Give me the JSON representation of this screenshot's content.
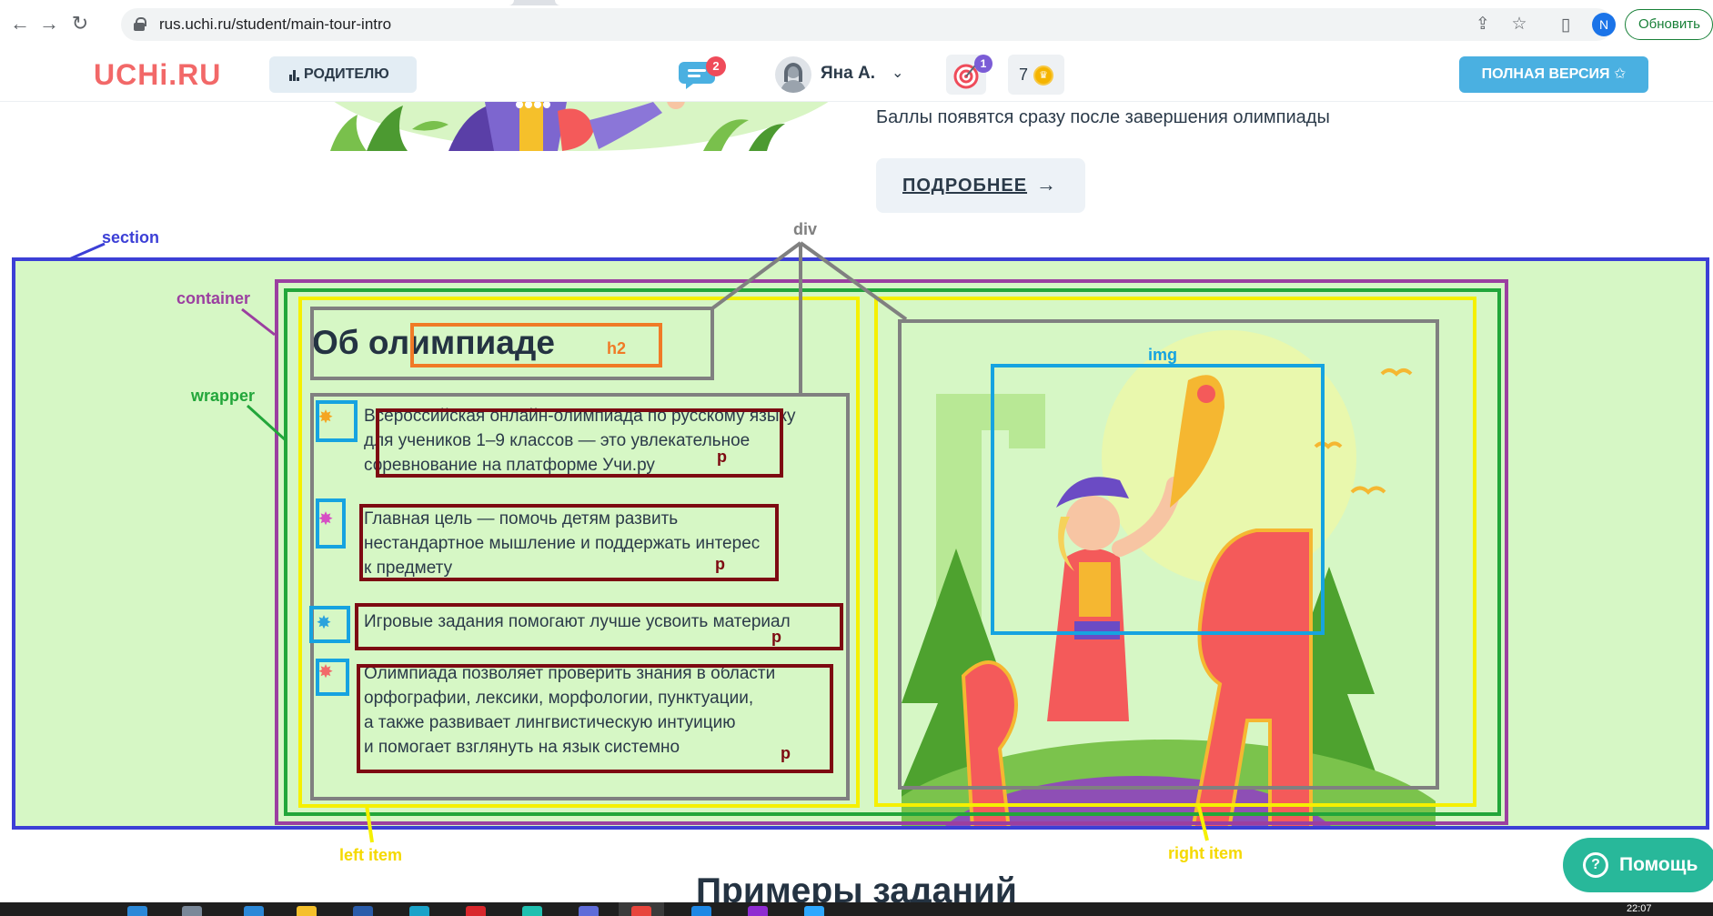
{
  "browser": {
    "url": "rus.uchi.ru/student/main-tour-intro",
    "profile_initial": "N",
    "update_label": "Обновить",
    "icons": [
      "back-icon",
      "forward-icon",
      "reload-icon",
      "lock-icon",
      "share-icon",
      "bookmark-star-icon",
      "side-panel-icon"
    ]
  },
  "header": {
    "logo": "UCHi.RU",
    "parent_button": "РОДИТЕЛЮ",
    "chat_badge": "2",
    "user_name": "Яна А.",
    "target_badge": "1",
    "coins": "7",
    "full_version": "ПОЛНАЯ ВЕРСИЯ ✩"
  },
  "top": {
    "score_note": "Баллы появятся сразу после завершения олимпиады",
    "more_button": "ПОДРОБНЕЕ",
    "more_arrow": "→"
  },
  "about": {
    "title": "Об олимпиаде",
    "paragraphs": [
      [
        "Всероссийская онлайн-олимпиада по русскому языку",
        "для учеников 1–9 классов — это увлекательное",
        "соревнование на платформе Учи.ру"
      ],
      [
        "Главная цель — помочь детям развить",
        "нестандартное мышление и поддержать интерес",
        "к предмету"
      ],
      [
        "Игровые задания помогают лучше усвоить материал"
      ],
      [
        "Олимпиада позволяет проверить знания в области",
        "орфографии, лексики, морфологии, пунктуации,",
        "а также развивает лингвистическую интуицию",
        "и помогает взглянуть на язык системно"
      ]
    ]
  },
  "annotations": {
    "section": "section",
    "container": "container",
    "wrapper": "wrapper",
    "div": "div",
    "h2": "h2",
    "img": "img",
    "p": "p",
    "left_item": "left item",
    "right_item": "right item",
    "colors": {
      "section": "#3c3fd6",
      "container": "#9b3fa0",
      "wrapper": "#22a63a",
      "item": "#f5f000",
      "div": "#808080",
      "h2": "#f07a26",
      "img": "#16a3e0",
      "p": "#7d0a12"
    }
  },
  "bottom": {
    "examples_title": "Примеры заданий",
    "help": "Помощь",
    "clock": "22:07"
  }
}
